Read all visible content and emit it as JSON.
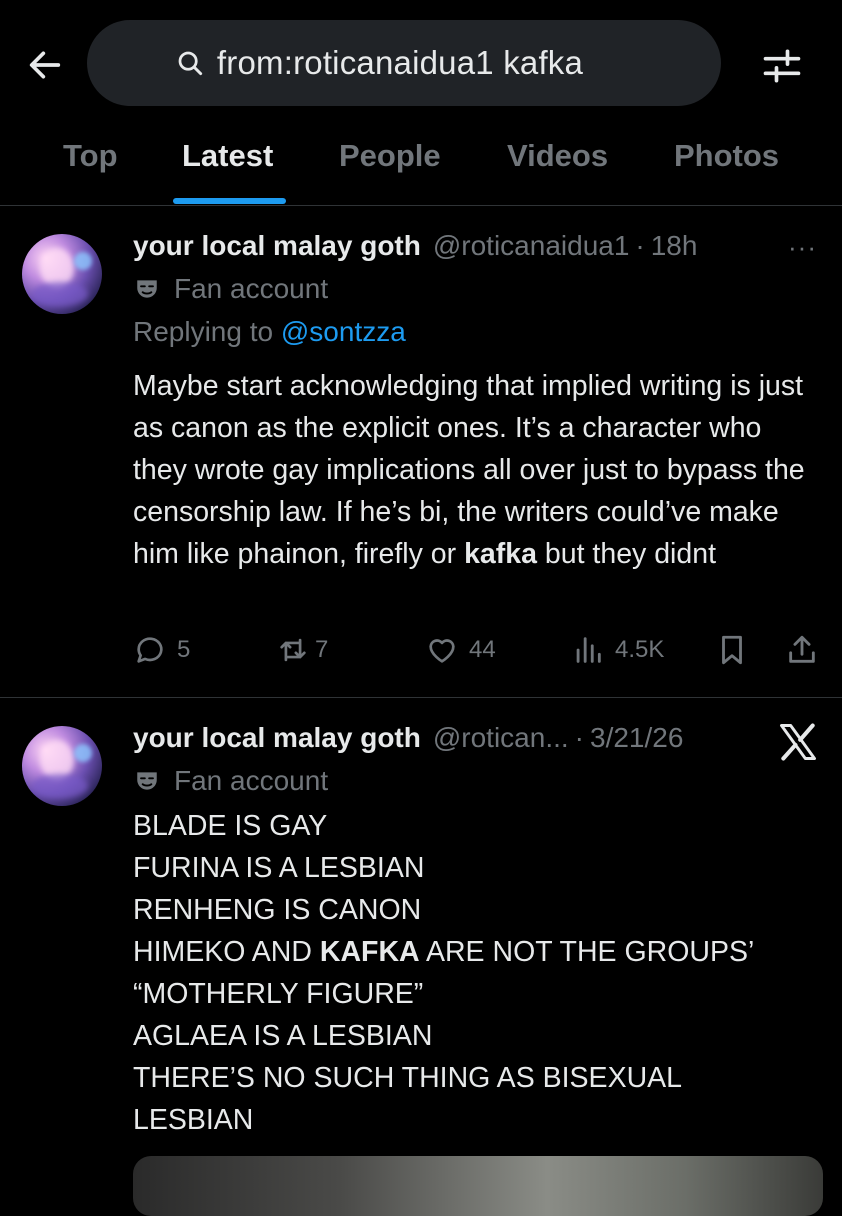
{
  "header": {
    "search_query": "from:roticanaidua1 kafka"
  },
  "tabs": [
    {
      "label": "Top"
    },
    {
      "label": "Latest"
    },
    {
      "label": "People"
    },
    {
      "label": "Videos"
    },
    {
      "label": "Photos"
    }
  ],
  "active_tab": "Latest",
  "tweets": [
    {
      "display_name": "your local malay goth",
      "handle": "@roticanaidua1",
      "time": "18h",
      "dot": "·",
      "more": "···",
      "badge": "Fan account",
      "replying_prefix": "Replying to",
      "replying_to": "@sontzza",
      "text_before": "Maybe start acknowledging that implied writing is just as canon as the explicit ones. It’s a character who they wrote gay implications all over just to bypass the censorship law. If he’s bi, the writers could’ve make him like phainon, firefly or ",
      "text_bold": "kafka",
      "text_after": " but they didnt",
      "stats": {
        "replies": "5",
        "reposts": "7",
        "likes": "44",
        "views": "4.5K"
      }
    },
    {
      "display_name": "your local malay goth",
      "handle": "@rotican...",
      "time": "3/21/26",
      "dot": "·",
      "badge": "Fan account",
      "lines": [
        "BLADE IS GAY",
        "FURINA IS A LESBIAN",
        "RENHENG IS CANON"
      ],
      "line4_before": "HIMEKO AND ",
      "line4_bold": "KAFKA",
      "line4_after": " ARE NOT THE GROUPS’",
      "lines_after": [
        "“MOTHERLY FIGURE”",
        "AGLAEA IS A LESBIAN",
        "THERE’S NO SUCH THING AS BISEXUAL",
        "LESBIAN"
      ]
    }
  ],
  "colors": {
    "background": "#000000",
    "text_primary": "#e7e9ea",
    "text_secondary": "#71767b",
    "accent": "#1d9bf0",
    "search_bg": "#202327",
    "divider": "#2f3336"
  },
  "icons": {
    "back": "arrow-left-icon",
    "search": "search-icon",
    "filter": "filter-sliders-icon",
    "reply": "reply-bubble-icon",
    "repost": "repost-icon",
    "like": "heart-icon",
    "views": "views-bars-icon",
    "bookmark": "bookmark-icon",
    "share": "share-icon",
    "x_logo": "x-logo-icon",
    "mask": "mask-icon"
  }
}
